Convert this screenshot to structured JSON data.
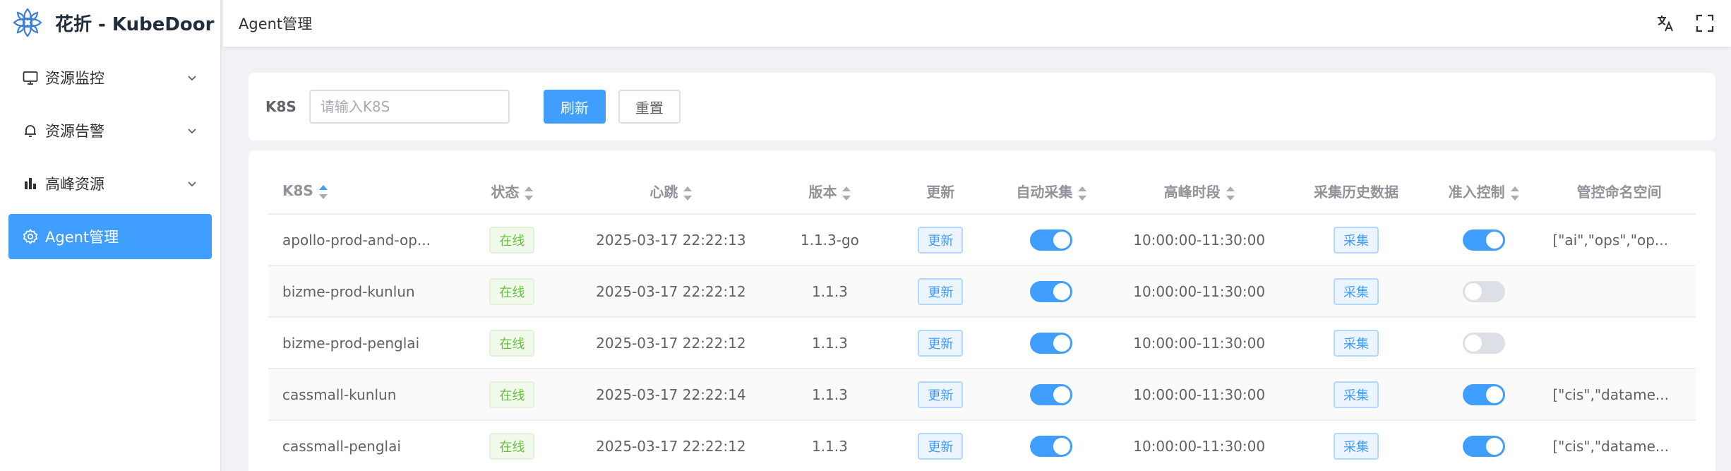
{
  "brand": {
    "title": "花折 - KubeDoor"
  },
  "sidebar": {
    "items": [
      {
        "label": "资源监控",
        "icon": "monitor-icon",
        "expandable": true,
        "active": false
      },
      {
        "label": "资源告警",
        "icon": "bell-icon",
        "expandable": true,
        "active": false
      },
      {
        "label": "高峰资源",
        "icon": "bar-chart-icon",
        "expandable": true,
        "active": false
      },
      {
        "label": "Agent管理",
        "icon": "gear-icon",
        "expandable": false,
        "active": true
      }
    ]
  },
  "header": {
    "breadcrumb": "Agent管理",
    "icons": [
      "translate-icon",
      "fullscreen-icon"
    ]
  },
  "search": {
    "label": "K8S",
    "placeholder": "请输入K8S",
    "value": "",
    "refresh_label": "刷新",
    "reset_label": "重置"
  },
  "table": {
    "columns": [
      "K8S",
      "状态",
      "心跳",
      "版本",
      "更新",
      "自动采集",
      "高峰时段",
      "采集历史数据",
      "准入控制",
      "管控命名空间"
    ],
    "rows": [
      {
        "k8s": "apollo-prod-and-op...",
        "status": "在线",
        "heartbeat": "2025-03-17 22:22:13",
        "version": "1.1.3-go",
        "update": "更新",
        "auto_collect": true,
        "peak": "10:00:00-11:30:00",
        "collect": "采集",
        "admission": true,
        "namespaces": "[\"ai\",\"ops\",\"op..."
      },
      {
        "k8s": "bizme-prod-kunlun",
        "status": "在线",
        "heartbeat": "2025-03-17 22:22:12",
        "version": "1.1.3",
        "update": "更新",
        "auto_collect": true,
        "peak": "10:00:00-11:30:00",
        "collect": "采集",
        "admission": false,
        "namespaces": ""
      },
      {
        "k8s": "bizme-prod-penglai",
        "status": "在线",
        "heartbeat": "2025-03-17 22:22:12",
        "version": "1.1.3",
        "update": "更新",
        "auto_collect": true,
        "peak": "10:00:00-11:30:00",
        "collect": "采集",
        "admission": false,
        "namespaces": ""
      },
      {
        "k8s": "cassmall-kunlun",
        "status": "在线",
        "heartbeat": "2025-03-17 22:22:14",
        "version": "1.1.3",
        "update": "更新",
        "auto_collect": true,
        "peak": "10:00:00-11:30:00",
        "collect": "采集",
        "admission": true,
        "namespaces": "[\"cis\",\"datame..."
      },
      {
        "k8s": "cassmall-penglai",
        "status": "在线",
        "heartbeat": "2025-03-17 22:22:12",
        "version": "1.1.3",
        "update": "更新",
        "auto_collect": true,
        "peak": "10:00:00-11:30:00",
        "collect": "采集",
        "admission": true,
        "namespaces": "[\"cis\",\"datame..."
      }
    ]
  },
  "colors": {
    "primary": "#409eff",
    "success": "#67c23a",
    "sidebar_bg": "#ffffff",
    "page_bg": "#f0f2f5"
  }
}
